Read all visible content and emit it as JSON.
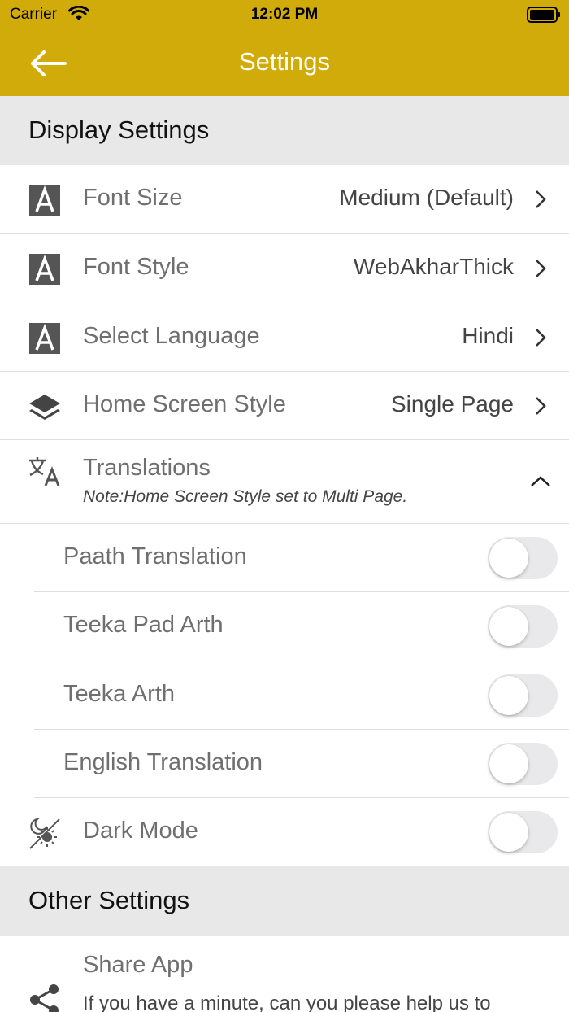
{
  "status_bar": {
    "carrier": "Carrier",
    "time": "12:02 PM"
  },
  "nav": {
    "title": "Settings"
  },
  "display_settings": {
    "header": "Display Settings",
    "font_size": {
      "label": "Font Size",
      "value": "Medium (Default)"
    },
    "font_style": {
      "label": "Font Style",
      "value": "WebAkharThick"
    },
    "language": {
      "label": "Select Language",
      "value": "Hindi"
    },
    "home_style": {
      "label": "Home Screen Style",
      "value": "Single Page"
    },
    "translations": {
      "label": "Translations",
      "note": "Note:Home Screen Style set to Multi Page.",
      "items": [
        {
          "label": "Paath Translation",
          "enabled": false
        },
        {
          "label": "Teeka Pad Arth",
          "enabled": false
        },
        {
          "label": "Teeka Arth",
          "enabled": false
        },
        {
          "label": "English Translation",
          "enabled": false
        }
      ]
    },
    "dark_mode": {
      "label": "Dark Mode",
      "enabled": false
    }
  },
  "other_settings": {
    "header": "Other Settings",
    "share_app": {
      "label": "Share App",
      "description": "If you have a minute, can you please help us to"
    }
  },
  "colors": {
    "accent": "#d1ab09",
    "section_bg": "#e8e8e8",
    "toggle_off": "#e9e9eb"
  }
}
